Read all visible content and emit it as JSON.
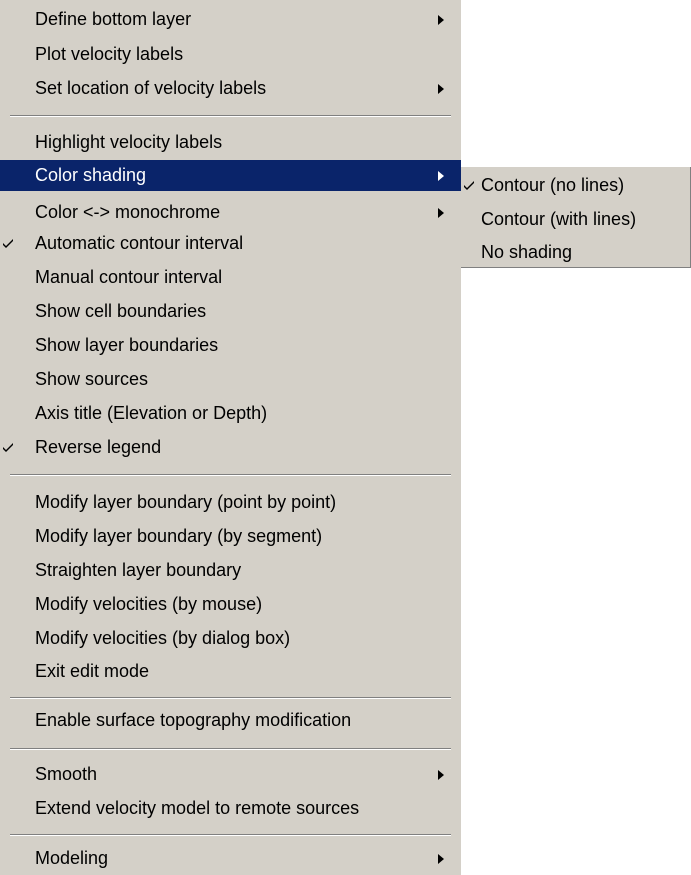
{
  "menu": {
    "items": [
      {
        "label": "Define bottom layer",
        "checked": false,
        "submenu": true
      },
      {
        "label": "Plot velocity labels",
        "checked": false,
        "submenu": false
      },
      {
        "label": "Set location of velocity labels",
        "checked": false,
        "submenu": true
      },
      {
        "label": "Highlight velocity labels",
        "checked": false,
        "submenu": false
      },
      {
        "label": "Color shading",
        "checked": false,
        "submenu": true,
        "selected": true
      },
      {
        "label": "Color <-> monochrome",
        "checked": false,
        "submenu": true
      },
      {
        "label": "Automatic contour interval",
        "checked": true,
        "submenu": false
      },
      {
        "label": "Manual contour interval",
        "checked": false,
        "submenu": false
      },
      {
        "label": "Show cell boundaries",
        "checked": false,
        "submenu": false
      },
      {
        "label": "Show layer boundaries",
        "checked": false,
        "submenu": false
      },
      {
        "label": "Show sources",
        "checked": false,
        "submenu": false
      },
      {
        "label": "Axis title (Elevation or Depth)",
        "checked": false,
        "submenu": false
      },
      {
        "label": "Reverse legend",
        "checked": true,
        "submenu": false
      },
      {
        "label": "Modify layer boundary (point by point)",
        "checked": false,
        "submenu": false
      },
      {
        "label": "Modify layer boundary (by segment)",
        "checked": false,
        "submenu": false
      },
      {
        "label": "Straighten layer boundary",
        "checked": false,
        "submenu": false
      },
      {
        "label": "Modify velocities (by mouse)",
        "checked": false,
        "submenu": false
      },
      {
        "label": "Modify velocities (by dialog box)",
        "checked": false,
        "submenu": false
      },
      {
        "label": "Exit edit mode",
        "checked": false,
        "submenu": false
      },
      {
        "label": "Enable surface topography modification",
        "checked": false,
        "submenu": false
      },
      {
        "label": "Smooth",
        "checked": false,
        "submenu": true
      },
      {
        "label": "Extend velocity model to remote sources",
        "checked": false,
        "submenu": false
      },
      {
        "label": "Modeling",
        "checked": false,
        "submenu": true
      }
    ]
  },
  "submenu": {
    "items": [
      {
        "label": "Contour (no lines)",
        "checked": true
      },
      {
        "label": "Contour (with lines)",
        "checked": false
      },
      {
        "label": "No shading",
        "checked": false
      }
    ]
  },
  "colors": {
    "menu_background": "#d4d0c8",
    "highlight_background": "#0a246a",
    "highlight_text": "#ffffff",
    "text": "#000000"
  },
  "icons": {
    "check": "checkmark-icon",
    "submenu_arrow": "submenu-arrow-icon"
  }
}
